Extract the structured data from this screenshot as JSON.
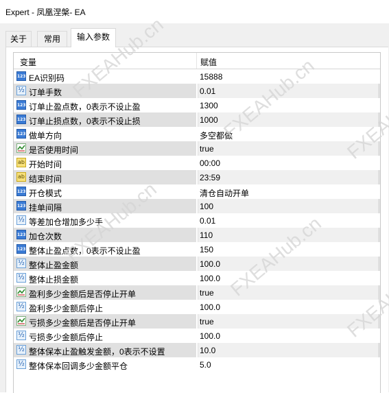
{
  "window": {
    "title": "Expert - 凤凰涅槃- EA"
  },
  "tabs": [
    {
      "label": "关于"
    },
    {
      "label": "常用"
    },
    {
      "label": "输入参数"
    }
  ],
  "grid": {
    "col_variable": "变量",
    "col_value": "赋值",
    "rows": [
      {
        "icon": "int",
        "name": "EA识别码",
        "value": "15888"
      },
      {
        "icon": "double",
        "name": "订单手数",
        "value": "0.01"
      },
      {
        "icon": "int",
        "name": "订单止盈点数，0表示不设止盈",
        "value": "1300"
      },
      {
        "icon": "int",
        "name": "订单止损点数，0表示不设止损",
        "value": "1000"
      },
      {
        "icon": "enum",
        "name": "做单方向",
        "value": "多空都做"
      },
      {
        "icon": "bool",
        "name": "是否使用时间",
        "value": "true"
      },
      {
        "icon": "string",
        "name": "开始时间",
        "value": "00:00"
      },
      {
        "icon": "string",
        "name": "结束时间",
        "value": "23:59"
      },
      {
        "icon": "enum",
        "name": "开仓模式",
        "value": "清仓自动开单"
      },
      {
        "icon": "int",
        "name": "挂单间隔",
        "value": "100"
      },
      {
        "icon": "double",
        "name": "等差加仓增加多少手",
        "value": "0.01"
      },
      {
        "icon": "int",
        "name": "加仓次数",
        "value": "110"
      },
      {
        "icon": "int",
        "name": "整体止盈点数，0表示不设止盈",
        "value": "150"
      },
      {
        "icon": "double",
        "name": "整体止盈金额",
        "value": "100.0"
      },
      {
        "icon": "double",
        "name": "整体止损金额",
        "value": "100.0"
      },
      {
        "icon": "bool",
        "name": "盈利多少金额后是否停止开单",
        "value": "true"
      },
      {
        "icon": "double",
        "name": "盈利多少金额后停止",
        "value": "100.0"
      },
      {
        "icon": "bool",
        "name": "亏损多少金额后是否停止开单",
        "value": "true"
      },
      {
        "icon": "double",
        "name": "亏损多少金额后停止",
        "value": "100.0"
      },
      {
        "icon": "double",
        "name": "整体保本止盈触发金额，0表示不设置",
        "value": "10.0"
      },
      {
        "icon": "double",
        "name": "整体保本回调多少金额平仓",
        "value": "5.0"
      }
    ]
  },
  "watermarks": [
    "FXEAHub.cn",
    "FXEAHub.cn",
    "FXEAHub.cn",
    "FXEAHub.cn",
    "FXEAHub.cn",
    "FXEAHub.cn"
  ]
}
